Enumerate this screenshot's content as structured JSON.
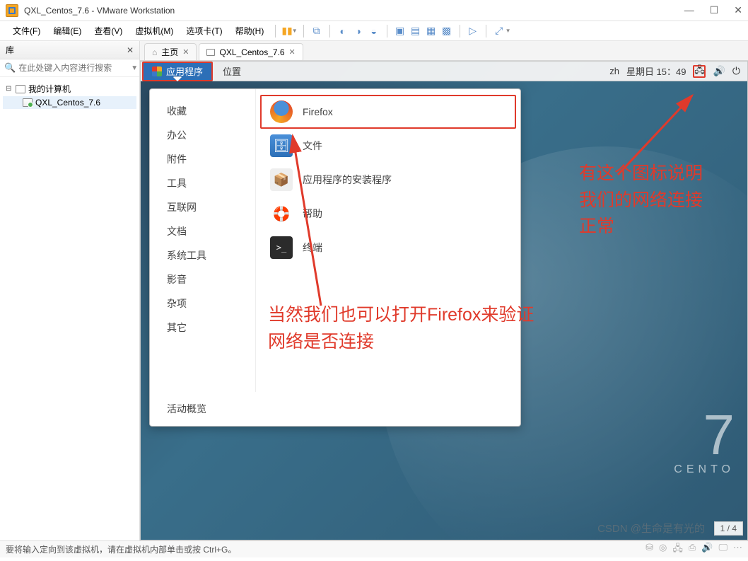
{
  "window": {
    "title": "QXL_Centos_7.6 - VMware Workstation"
  },
  "menu": {
    "items": [
      "文件(F)",
      "编辑(E)",
      "查看(V)",
      "虚拟机(M)",
      "选项卡(T)",
      "帮助(H)"
    ]
  },
  "library": {
    "title": "库",
    "search_placeholder": "在此处键入内容进行搜索",
    "root": "我的计算机",
    "vm": "QXL_Centos_7.6"
  },
  "tabs": {
    "home": "主页",
    "vm": "QXL_Centos_7.6"
  },
  "gnome": {
    "apps": "应用程序",
    "places": "位置",
    "lang": "zh",
    "clock": "星期日 15：49"
  },
  "appmenu": {
    "categories": [
      "收藏",
      "办公",
      "附件",
      "工具",
      "互联网",
      "文档",
      "系统工具",
      "影音",
      "杂项",
      "其它"
    ],
    "apps": {
      "firefox": "Firefox",
      "files": "文件",
      "installer": "应用程序的安装程序",
      "help": "帮助",
      "terminal": "终端"
    },
    "activities": "活动概览"
  },
  "centos": {
    "num": "7",
    "word": "CENTO"
  },
  "annotations": {
    "net": "有这个图标说明\n我们的网络连接\n正常",
    "ff": "当然我们也可以打开Firefox来验证\n网络是否连接",
    "watermark": "CSDN @生命是有光的"
  },
  "pager": "1 / 4",
  "statusbar": {
    "text": "要将输入定向到该虚拟机，请在虚拟机内部单击或按 Ctrl+G。"
  }
}
